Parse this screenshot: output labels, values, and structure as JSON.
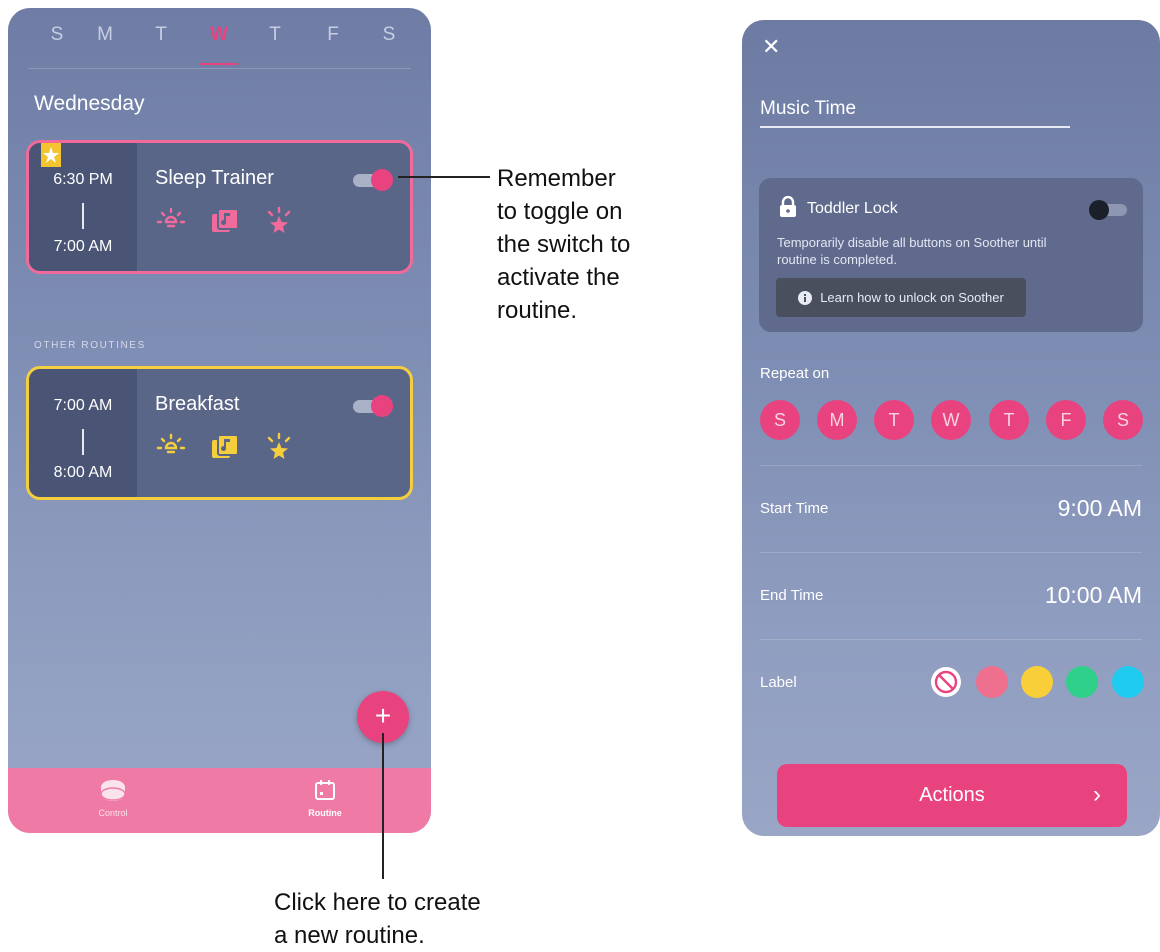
{
  "left_screen": {
    "days": [
      "S",
      "M",
      "T",
      "W",
      "T",
      "F",
      "S"
    ],
    "active_day_index": 3,
    "day_title": "Wednesday",
    "other_routines_label": "OTHER ROUTINES",
    "routines": [
      {
        "name": "Sleep Trainer",
        "start": "6:30 PM",
        "end": "7:00 AM",
        "enabled": true,
        "starred": true,
        "accent": "#f06b9b",
        "icons": [
          "light-icon",
          "music-icon",
          "sparkle-icon"
        ]
      },
      {
        "name": "Breakfast",
        "start": "7:00 AM",
        "end": "8:00 AM",
        "enabled": true,
        "starred": false,
        "accent": "#f4ce3c",
        "icons": [
          "light-icon",
          "music-icon",
          "sparkle-icon"
        ]
      }
    ],
    "fab_label": "+",
    "nav": [
      {
        "label": "Control",
        "icon": "soother-device-icon"
      },
      {
        "label": "Routine",
        "icon": "calendar-icon"
      }
    ]
  },
  "annotations": {
    "toggle_note": [
      "Remember",
      "to toggle on",
      "the switch to",
      "activate the",
      "routine."
    ],
    "fab_note": [
      "Click here to create",
      "a new routine."
    ]
  },
  "right_screen": {
    "close_label": "✕",
    "routine_name": "Music Time",
    "toddler_lock": {
      "title": "Toddler Lock",
      "enabled": false,
      "description": "Temporarily disable all buttons on Soother until routine is completed.",
      "learn_button": "Learn how to unlock on Soother"
    },
    "repeat_label": "Repeat on",
    "repeat_days": [
      "S",
      "M",
      "T",
      "W",
      "T",
      "F",
      "S"
    ],
    "start_time_label": "Start Time",
    "start_time_value": "9:00 AM",
    "end_time_label": "End Time",
    "end_time_value": "10:00 AM",
    "label_label": "Label",
    "label_colors": [
      "none",
      "#ef6f8e",
      "#f8cf38",
      "#2fd089",
      "#1fcbef"
    ],
    "actions_button": "Actions",
    "actions_chevron": "›"
  },
  "colors": {
    "accent_pink": "#e8437f",
    "nav_pink": "#ef7aa5",
    "card_bg": "#5a6688"
  }
}
